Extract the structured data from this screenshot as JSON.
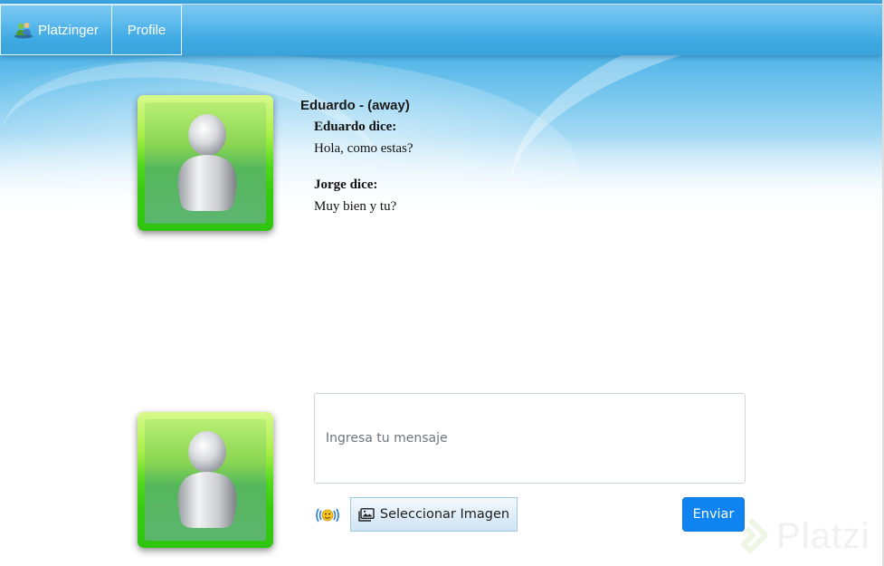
{
  "nav": {
    "brand_label": "Platzinger",
    "brand_icon": "users-icon",
    "profile_label": "Profile"
  },
  "chat": {
    "title": "Eduardo - (away)",
    "messages": [
      {
        "sender": "Eduardo dice:",
        "text": "Hola, como estas?"
      },
      {
        "sender": "Jorge dice:",
        "text": "Muy bien y tu?"
      }
    ]
  },
  "composer": {
    "placeholder": "Ingresa tu mensaje",
    "value": "",
    "nudge_icon": "nudge-icon",
    "select_image_label": "Seleccionar Imagen",
    "select_image_icon": "image-icon",
    "send_label": "Enviar"
  },
  "avatars": {
    "contact_icon": "user-avatar-icon",
    "self_icon": "user-avatar-icon"
  },
  "watermark": {
    "label": "Platzi"
  },
  "colors": {
    "topbar": "#3fa9e2",
    "send_button": "#0f84f0",
    "avatar_green": "#37cc12"
  }
}
